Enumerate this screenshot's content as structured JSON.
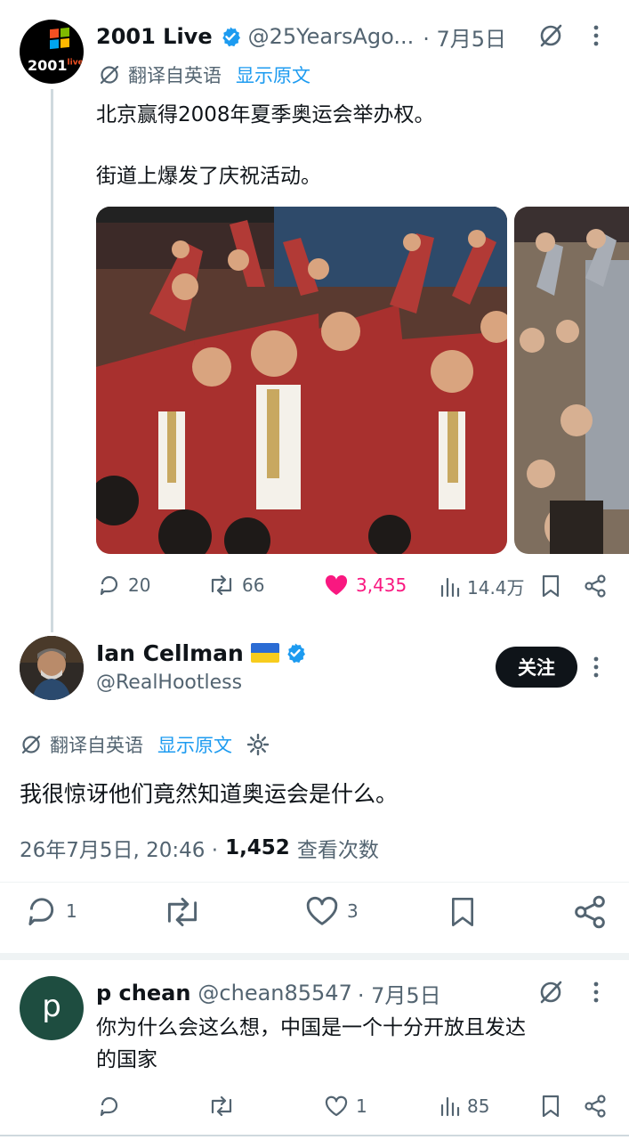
{
  "tweet1": {
    "name": "2001 Live",
    "handle": "@25YearsAgo...",
    "date": "· 7月5日",
    "avatar_logo": "2001",
    "avatar_logo_sup": "live",
    "translate_label": "翻译自英语",
    "show_original": "显示原文",
    "text_line1": "北京赢得2008年夏季奥运会举办权。",
    "text_line2": "街道上爆发了庆祝活动。",
    "stats": {
      "replies": "20",
      "retweets": "66",
      "likes": "3,435",
      "views": "14.4万"
    }
  },
  "tweet2": {
    "name": "Ian Cellman",
    "flag": "ukraine-flag",
    "handle": "@RealHootless",
    "follow_label": "关注",
    "translate_label": "翻译自英语",
    "show_original": "显示原文",
    "text": "我很惊讶他们竟然知道奥运会是什么。",
    "timestamp": "26年7月5日, 20:46 ·",
    "view_count": "1,452",
    "view_label": "查看次数",
    "stats": {
      "replies": "1",
      "likes": "3"
    }
  },
  "tweet3": {
    "name": "p chean",
    "handle": "@chean85547",
    "date": "· 7月5日",
    "avatar_letter": "p",
    "text_line1": "你为什么会这么想，中国是一个十分开放且发达",
    "text_line2": "的国家",
    "stats": {
      "likes": "1",
      "views": "85"
    }
  },
  "colors": {
    "accent": "#1d9bf0",
    "like": "#f91880",
    "text": "#0f1419",
    "muted": "#536471",
    "avatar_green": "#1e4d40"
  }
}
